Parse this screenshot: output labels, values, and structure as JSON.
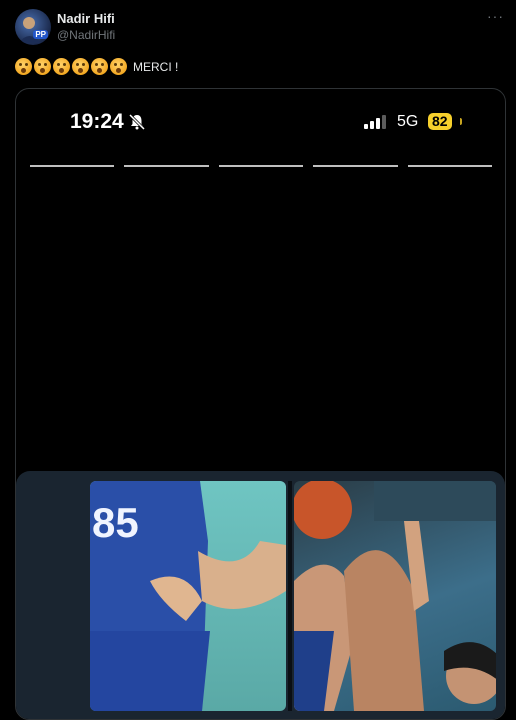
{
  "author": {
    "display_name": "Nadir Hifi",
    "handle": "@NadirHifi",
    "avatar_badge": "PP"
  },
  "menu": {
    "icon": "more-horizontal-icon",
    "glyph": "···"
  },
  "tweet": {
    "emoji_name": "hushed-face-emoji",
    "emoji_count": 6,
    "text": "MERCI !"
  },
  "media": {
    "status_bar": {
      "time": "19:24",
      "network": "5G",
      "battery": "82",
      "battery_color": "#f7d02c"
    },
    "story_segments": 5,
    "video": {
      "jersey_number": "85"
    }
  }
}
